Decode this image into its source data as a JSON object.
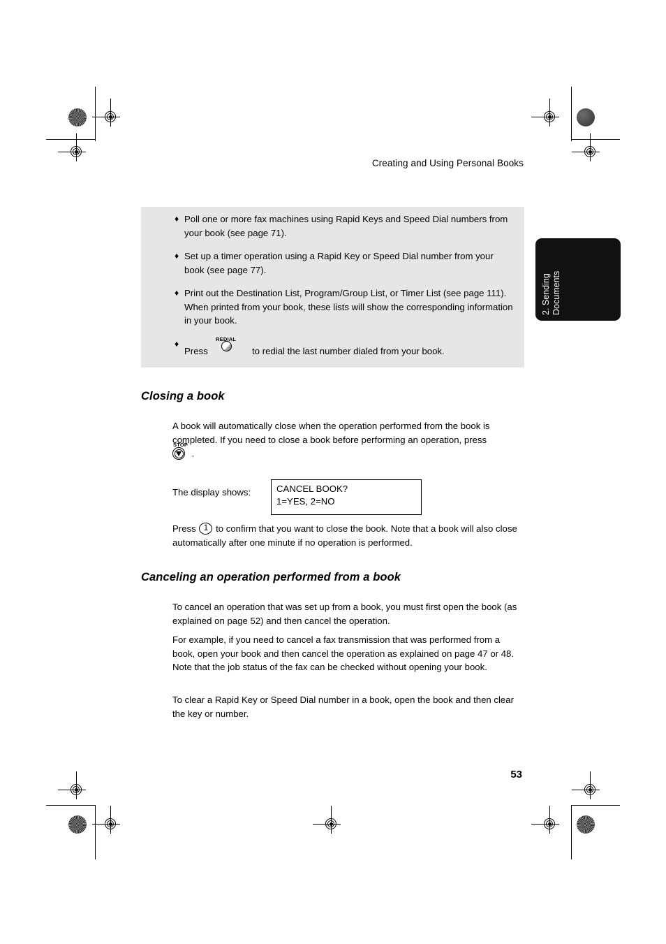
{
  "page": {
    "running_head": "Creating and Using Personal Books",
    "number": "53"
  },
  "note_box": {
    "bullet_marker": "♦",
    "bullets": [
      {
        "text": "Poll one or more fax machines using Rapid Keys and Speed Dial numbers from your book (see page 71)."
      },
      {
        "text": "Set up a timer operation using a Rapid Key or Speed Dial number from your book (see page 77)."
      },
      {
        "text": "Print out the Destination List, Program/Group List, or Timer List (see page 111). When printed from your book, these lists will show the corresponding information in your book."
      }
    ],
    "redial_bullet": {
      "press_label": "Press",
      "key_label": "REDIAL",
      "after_text": "to redial the last number dialed from your book."
    }
  },
  "sections": [
    {
      "heading": "Closing a book",
      "paragraph_1_before_key": "A book will automatically close when the operation performed from the book is completed. If you need to close a book before performing an operation, press",
      "stop_key_label": "STOP",
      "paragraph_1_after_key": ".",
      "display_label": "The display shows:",
      "display_line_1": "CANCEL BOOK?",
      "display_line_2": "1=YES, 2=NO",
      "press_label": "Press",
      "numeric_key": "1",
      "paragraph_2_after_key": "to confirm that you want to close the book. Note that a book will also close automatically after one minute if no operation is performed."
    },
    {
      "heading": "Canceling an operation performed from a book",
      "paragraphs": [
        "To cancel an operation that was set up from a book, you must first open the book (as explained on page 52) and then cancel the operation.",
        "For example, if you need to cancel a fax transmission that was performed from a book, open your book and then cancel the operation as explained on page 47 or 48. Note that the job status of the fax can be checked without opening your book.",
        "To clear a Rapid Key or Speed Dial number in a book, open the book and then clear the key or number."
      ]
    }
  ],
  "side_tab": {
    "line_1": "2. Sending",
    "line_2": "Documents"
  },
  "colors": {
    "note_box_background": "#e6e6e6",
    "side_tab_background": "#111111",
    "text": "#000000"
  }
}
